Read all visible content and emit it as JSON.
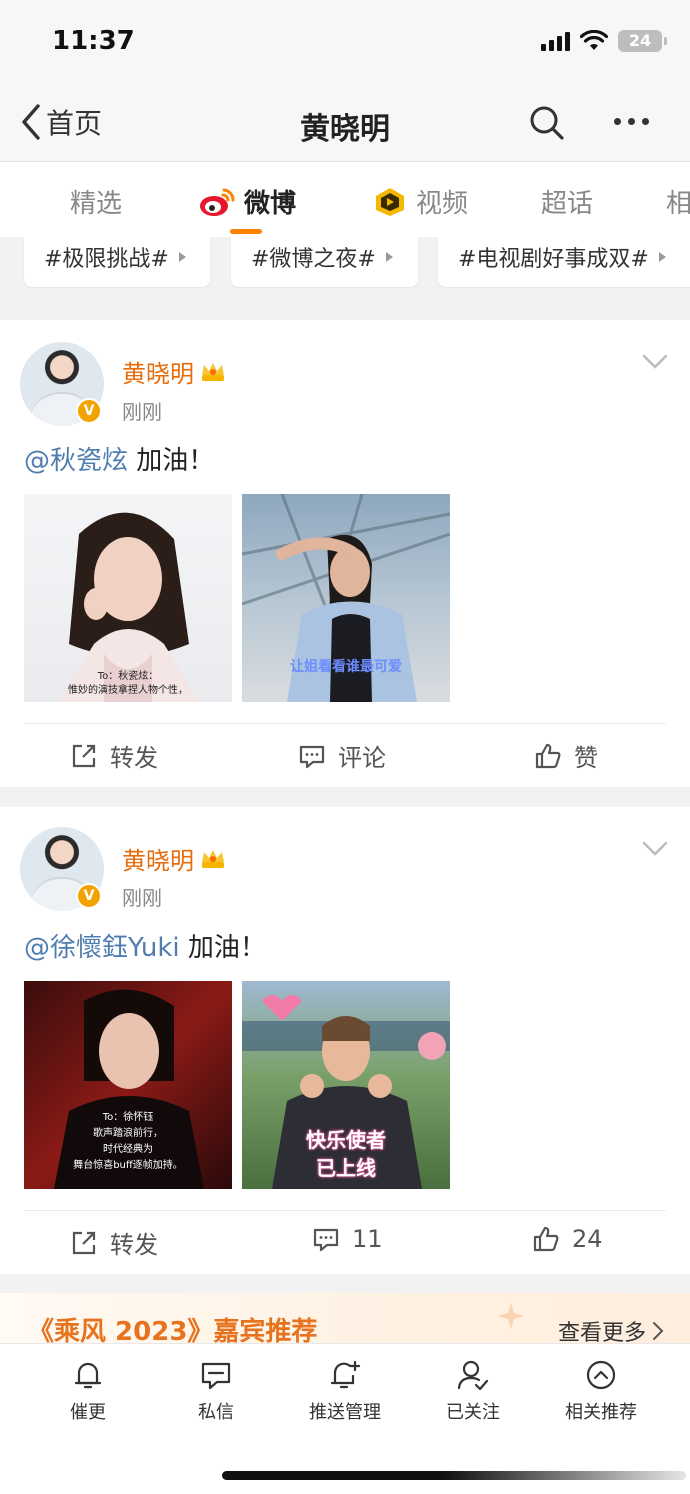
{
  "status_bar": {
    "time": "11:37",
    "battery": "24"
  },
  "nav": {
    "back_label": "首页",
    "title": "黄晓明"
  },
  "tabs": [
    {
      "label": "精选",
      "active": false
    },
    {
      "label": "微博",
      "active": true
    },
    {
      "label": "视频",
      "active": false
    },
    {
      "label": "超话",
      "active": false
    },
    {
      "label": "相",
      "active": false
    }
  ],
  "topics": [
    "#极限挑战#",
    "#微博之夜#",
    "#电视剧好事成双#"
  ],
  "posts": [
    {
      "author": "黄晓明",
      "time": "刚刚",
      "mention": "@秋瓷炫",
      "text": " 加油！",
      "images": [
        {
          "caption_1": "To：秋瓷炫：",
          "caption_2": "惟妙的演技拿捏人物个性，"
        },
        {
          "caption_1": "让姐看看谁最可爱",
          "caption_2": ""
        }
      ],
      "actions": {
        "repost": "转发",
        "comment": "评论",
        "like": "赞"
      }
    },
    {
      "author": "黄晓明",
      "time": "刚刚",
      "mention": "@徐懷鈺Yuki",
      "text": " 加油！",
      "images": [
        {
          "caption_1": "To：徐怀钰",
          "caption_2": "歌声踏浪前行，",
          "caption_3": "时代经典为",
          "caption_4": "舞台惊喜buff逐帧加持。"
        },
        {
          "caption_1": "快乐使者",
          "caption_2": "已上线"
        }
      ],
      "actions": {
        "repost": "转发",
        "comment": "11",
        "like": "24"
      }
    }
  ],
  "banner": {
    "title": "《乘风 2023》嘉宾推荐",
    "more": "查看更多"
  },
  "tabbar": [
    {
      "label": "催更",
      "icon": "bell-icon"
    },
    {
      "label": "私信",
      "icon": "message-icon"
    },
    {
      "label": "推送管理",
      "icon": "bell-plus-icon"
    },
    {
      "label": "已关注",
      "icon": "user-check-icon"
    },
    {
      "label": "相关推荐",
      "icon": "chevron-circle-icon"
    }
  ],
  "colors": {
    "accent": "#ff8200",
    "author": "#e86b0a",
    "mention": "#507daf"
  }
}
